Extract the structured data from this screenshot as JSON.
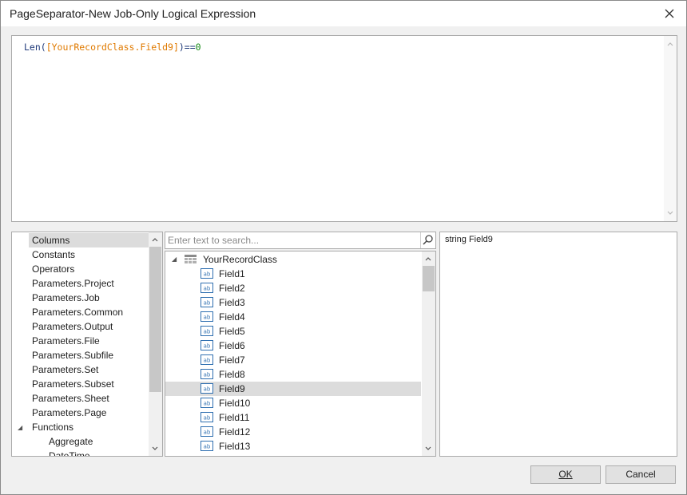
{
  "window": {
    "title": "PageSeparator-New Job-Only Logical Expression"
  },
  "icons": {
    "close": "close-icon",
    "search": "search-icon",
    "field": "string-field-icon",
    "class": "table-icon"
  },
  "expression": {
    "function": "Len(",
    "field": "[YourRecordClass.Field9]",
    "operator": ")==",
    "value": "0"
  },
  "categories": {
    "selected": "Columns",
    "items": [
      "Columns",
      "Constants",
      "Operators",
      "Parameters.Project",
      "Parameters.Job",
      "Parameters.Common",
      "Parameters.Output",
      "Parameters.File",
      "Parameters.Subfile",
      "Parameters.Set",
      "Parameters.Subset",
      "Parameters.Sheet",
      "Parameters.Page",
      "Functions"
    ],
    "sub_items": [
      "Aggregate",
      "DateTime"
    ]
  },
  "search": {
    "placeholder": "Enter text to search..."
  },
  "record_class": {
    "name": "YourRecordClass"
  },
  "fields": {
    "selected": "Field9",
    "items": [
      "Field1",
      "Field2",
      "Field3",
      "Field4",
      "Field5",
      "Field6",
      "Field7",
      "Field8",
      "Field9",
      "Field10",
      "Field11",
      "Field12",
      "Field13"
    ]
  },
  "description": {
    "text": "string Field9"
  },
  "buttons": {
    "ok": "OK",
    "cancel": "Cancel"
  }
}
